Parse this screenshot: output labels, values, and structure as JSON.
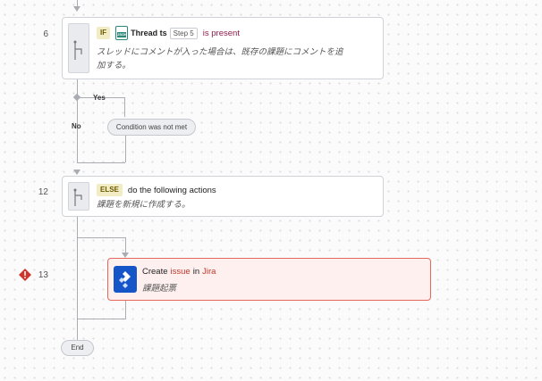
{
  "steps": {
    "if_step": {
      "number": "6",
      "tag": "IF",
      "app_icon_label": "JSON",
      "field_name": "Thread ts",
      "step_ref": "Step 5",
      "condition": "is present",
      "description_line1": "スレッドにコメントが入った場合は、既存の課題にコメントを追",
      "description_line2": "加する。"
    },
    "yes_branch_label": "Yes",
    "no_branch_label": "No",
    "condition_not_met": "Condition was not met",
    "else_step": {
      "number": "12",
      "tag": "ELSE",
      "headline": "do the following actions",
      "description": "課題を新規に作成する。"
    },
    "create_step": {
      "number": "13",
      "verb": "Create",
      "object": "issue",
      "connector": "in",
      "app": "Jira",
      "description": "課題起票"
    },
    "end_label": "End"
  },
  "colors": {
    "error": "#e5675c",
    "accent_red": "#c0392b",
    "jira_blue": "#1655c8",
    "connector_line": "#a9adb3"
  },
  "icons": {
    "if_step": "branch-icon",
    "else_step": "branch-icon",
    "create_step": "jira-logo-icon",
    "error": "error-diamond-icon"
  }
}
